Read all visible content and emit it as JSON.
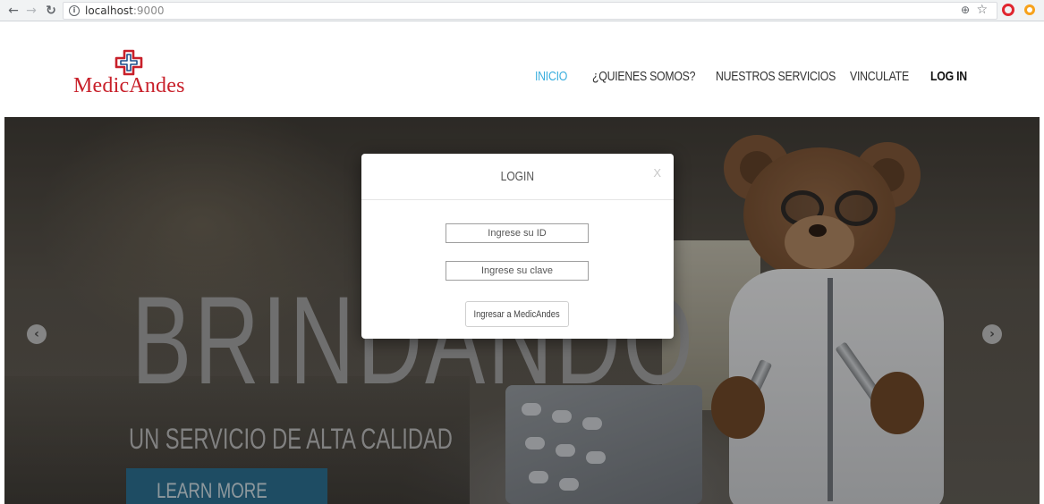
{
  "browser": {
    "url_host": "localhost",
    "url_port": ":9000",
    "back_icon": "arrow-left",
    "forward_icon": "arrow-right",
    "reload_icon": "reload",
    "info_icon": "i",
    "zoom_icon": "zoom",
    "star_icon": "star",
    "ext_icons": [
      "opera-icon",
      "extension-icon"
    ]
  },
  "header": {
    "logo_text": "MedicAndes",
    "nav": [
      {
        "label": "INICIO"
      },
      {
        "label": "¿QUIENES SOMOS?"
      },
      {
        "label": "NUESTROS SERVICIOS"
      },
      {
        "label": "VINCULATE"
      },
      {
        "label": "LOG IN"
      }
    ]
  },
  "hero": {
    "title": "BRINDANDO",
    "subtitle": "UN SERVICIO DE ALTA CALIDAD",
    "cta": "LEARN MORE",
    "prev_arrow": "‹",
    "next_arrow": "›"
  },
  "modal": {
    "title": "LOGIN",
    "close": "X",
    "id_placeholder": "Ingrese su ID",
    "password_placeholder": "Ingrese su clave",
    "submit": "Ingresar a MedicAndes"
  },
  "colors": {
    "brand_red": "#c8202a",
    "nav_active": "#3aaede",
    "cta_bg": "#2a6a8a"
  }
}
